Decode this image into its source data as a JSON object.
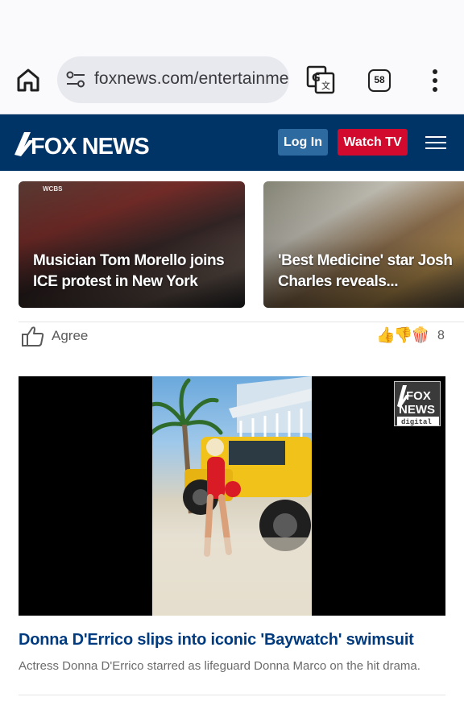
{
  "browser": {
    "url": "foxnews.com/entertainme",
    "tab_count": "58"
  },
  "header": {
    "logo_text": "FOX NEWS",
    "login_label": "Log In",
    "watch_label": "Watch TV",
    "colors": {
      "bar": "#003366",
      "login": "#2d6a9f",
      "watch": "#d20a2e"
    }
  },
  "carousel": [
    {
      "title": "Musician Tom Morello joins ICE protest in New York",
      "tag": "WCBS"
    },
    {
      "title": "'Best Medicine' star Josh Charles reveals..."
    }
  ],
  "reactions": {
    "agree_label": "Agree",
    "emojis": "👍👎🍿",
    "count": "8"
  },
  "video": {
    "badge_line1": "FOX",
    "badge_line2": "NEWS",
    "badge_line3": "digital"
  },
  "article": {
    "title": "Donna D'Errico slips into iconic 'Baywatch' swimsuit",
    "description": "Actress Donna D'Errico starred as lifeguard Donna Marco on the hit drama."
  }
}
